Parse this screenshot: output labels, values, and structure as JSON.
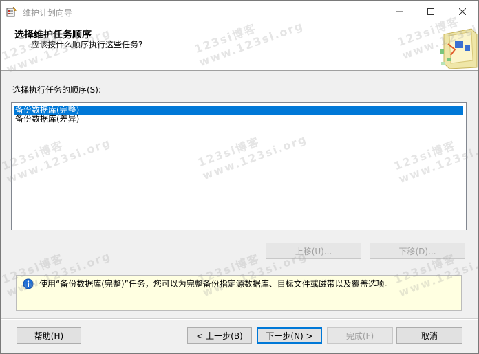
{
  "window": {
    "title": "维护计划向导"
  },
  "header": {
    "title": "选择维护任务顺序",
    "subtitle": "应该按什么顺序执行这些任务?"
  },
  "list": {
    "label": "选择执行任务的顺序(S):",
    "items": [
      {
        "label": "备份数据库(完整)",
        "selected": true
      },
      {
        "label": "备份数据库(差异)",
        "selected": false
      }
    ]
  },
  "order_buttons": {
    "up": "上移(U)...",
    "down": "下移(D)..."
  },
  "info": {
    "text": "使用“备份数据库(完整)”任务，您可以为完整备份指定源数据库、目标文件或磁带以及覆盖选项。"
  },
  "footer": {
    "help": "帮助(H)",
    "back": "< 上一步(B)",
    "next": "下一步(N) >",
    "finish": "完成(F)",
    "cancel": "取消"
  },
  "watermark": {
    "line1": "123si博客",
    "line2": "www.123si.org"
  },
  "colors": {
    "selection": "#0078d7",
    "info_background": "#ffffe1",
    "window_background": "#f0f0f0"
  }
}
